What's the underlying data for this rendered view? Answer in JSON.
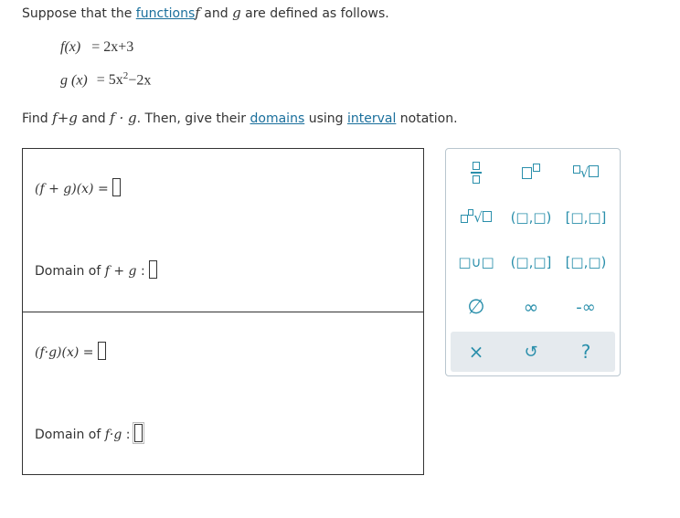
{
  "intro": {
    "prefix": "Suppose that the ",
    "functions_link": "functions",
    "f": "f",
    "and": " and ",
    "g": "g",
    "suffix": " are defined as follows."
  },
  "definitions": {
    "f_lhs": "f(x)",
    "f_rhs": "= 2x+3",
    "g_lhs": "g (x)",
    "g_rhs_a": "= 5x",
    "g_rhs_exp": "2",
    "g_rhs_b": "−2x"
  },
  "task": {
    "find": "Find ",
    "f_plus_g": "f+g",
    "and": " and ",
    "f_dot_g": "f · g",
    "mid": ". Then, give their ",
    "domains_link": "domains",
    "using": " using ",
    "interval_link": "interval",
    "notation": " notation."
  },
  "answers": {
    "sum_label": "(f + g)(x) =",
    "sum_domain_label": "Domain of",
    "sum_domain_expr": "f + g",
    "sum_domain_colon": ":",
    "prod_label": "(f·g)(x) =",
    "prod_domain_label": "Domain of",
    "prod_domain_expr": "f·g",
    "prod_domain_colon": ":"
  },
  "palette": {
    "open_paren_int": "(□,□)",
    "closed_int": "[□,□]",
    "open_closed_int": "(□,□]",
    "closed_open_int": "[□,□)",
    "union": "□∪□",
    "empty_set": "∅",
    "infinity": "∞",
    "neg_infinity": "-∞",
    "clear": "×",
    "undo": "↺",
    "help": "?"
  },
  "colors": {
    "accent": "#2a8fab",
    "link": "#1a6f9c",
    "toolbar_bg": "#e5eaee"
  }
}
